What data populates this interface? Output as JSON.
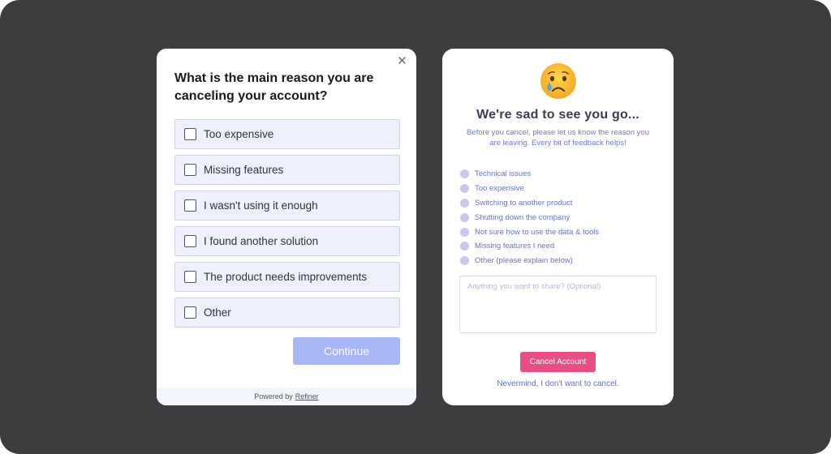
{
  "colors": {
    "backdrop": "#3d3d3f",
    "option_bg": "#eef1fd",
    "continue_button": "#a8b5f6",
    "cancel_button": "#e84e84",
    "accent_text": "#6b72c4"
  },
  "left_card": {
    "close_icon": "close-icon",
    "question": "What is the main reason you are canceling your account?",
    "options": [
      {
        "label": "Too expensive",
        "checked": false
      },
      {
        "label": "Missing features",
        "checked": false
      },
      {
        "label": "I wasn't using it enough",
        "checked": false
      },
      {
        "label": "I found another solution",
        "checked": false
      },
      {
        "label": "The product needs improvements",
        "checked": false
      },
      {
        "label": "Other",
        "checked": false
      }
    ],
    "continue_label": "Continue",
    "footer": {
      "prefix": "Powered by",
      "brand": "Refiner"
    }
  },
  "right_card": {
    "emoji": "crying-face-emoji",
    "title": "We're sad to see you go...",
    "subtitle": "Before you cancel, please let us know the reason you are leaving. Every bit of feedback helps!",
    "reasons": [
      "Technical issues",
      "Too expensive",
      "Switching to another product",
      "Shutting down the company",
      "Not sure how to use the data & tools",
      "Missing features I need",
      "Other (please explain below)"
    ],
    "share_placeholder": "Anything you want to share? (Optional)",
    "cancel_label": "Cancel Account",
    "nevermind_label": "Nevermind, I don't want to cancel."
  }
}
